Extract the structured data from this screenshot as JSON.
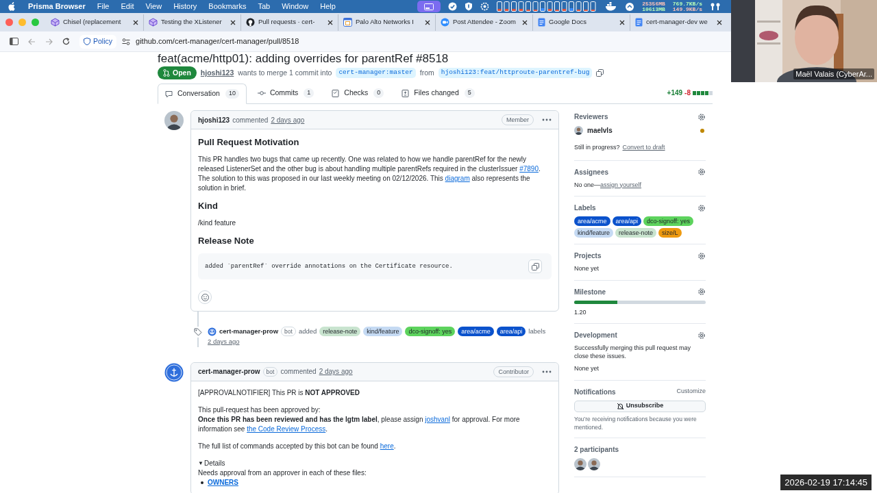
{
  "menu_bar": {
    "app": "Prisma Browser",
    "items": [
      "File",
      "Edit",
      "View",
      "History",
      "Bookmarks",
      "Tab",
      "Window",
      "Help"
    ],
    "stats": [
      [
        "25356MB",
        "10613MB"
      ],
      [
        "769.7KB/s",
        "149.9KB/s"
      ]
    ]
  },
  "browser_tabs": [
    {
      "title": "Chisel (replacement",
      "kind": "cube",
      "selected": false
    },
    {
      "title": "Testing the XListener",
      "kind": "cube",
      "selected": false
    },
    {
      "title": "Pull requests · cert-",
      "kind": "github",
      "selected": false
    },
    {
      "title": "Palo Alto Networks I",
      "kind": "calendar",
      "selected": false
    },
    {
      "title": "Post Attendee - Zoom",
      "kind": "zoom",
      "selected": false
    },
    {
      "title": "Google Docs",
      "kind": "doc",
      "selected": false
    },
    {
      "title": "cert-manager-dev we",
      "kind": "doc",
      "selected": false
    }
  ],
  "address_bar": {
    "policy": "Policy",
    "url": "github.com/cert-manager/cert-manager/pull/8518"
  },
  "pull_request": {
    "title": "feat(acme/http01): adding overrides for parentRef #8518",
    "state": "Open",
    "author": "hjoshi123",
    "merge_text": "wants to merge 1 commit into",
    "base": "cert-manager:master",
    "from": "from",
    "head": "hjoshi123:feat/httproute-parentref-bug",
    "tabs": [
      {
        "label": "Conversation",
        "count": "10",
        "selected": true
      },
      {
        "label": "Commits",
        "count": "1",
        "selected": false
      },
      {
        "label": "Checks",
        "count": "0",
        "selected": false
      },
      {
        "label": "Files changed",
        "count": "5",
        "selected": false
      }
    ],
    "additions": "+149",
    "deletions": "-8"
  },
  "timeline": [
    {
      "kind": "comment",
      "author": "hjoshi123",
      "action": "commented",
      "time": "2 days ago",
      "role": "Member",
      "body": [
        {
          "kind": "heading",
          "text": "Pull Request Motivation"
        },
        {
          "kind": "paragraph",
          "segments": [
            {
              "kind": "text",
              "text": "This PR handles two bugs that came up recently. One was related to how we handle parentRef for the newly released ListenerSet and the other bug is about handling multiple parentRefs required in the clusterIssuer "
            },
            {
              "kind": "link",
              "text": "#7890"
            },
            {
              "kind": "text",
              "text": ". The solution to this was proposed in our last weekly meeting on 02/12/2026. This "
            },
            {
              "kind": "link",
              "text": "diagram"
            },
            {
              "kind": "text",
              "text": " also represents the solution in brief."
            }
          ]
        },
        {
          "kind": "heading",
          "text": "Kind"
        },
        {
          "kind": "paragraph",
          "segments": [
            {
              "kind": "text",
              "text": "/kind feature"
            }
          ]
        },
        {
          "kind": "heading",
          "text": "Release Note"
        },
        {
          "kind": "code",
          "text": "added `parentRef` override annotations on the Certificate resource."
        },
        {
          "kind": "reactions"
        }
      ]
    },
    {
      "kind": "event",
      "author": "cert-manager-prow",
      "badge": "bot",
      "action": "added",
      "labels": [
        {
          "name": "release-note",
          "color": "#c9e4cf"
        },
        {
          "name": "kind/feature",
          "color": "#c5daf3"
        },
        {
          "name": "dco-signoff: yes",
          "color": "#5dd35d"
        },
        {
          "name": "area/acme",
          "color": "#0b52cc"
        },
        {
          "name": "area/api",
          "color": "#0b52cc"
        }
      ],
      "suffix": "labels",
      "time": "2 days ago"
    },
    {
      "kind": "comment",
      "author": "cert-manager-prow",
      "badge": "bot",
      "action": "commented",
      "time": "2 days ago",
      "role": "Contributor",
      "body": [
        {
          "kind": "paragraph",
          "segments": [
            {
              "kind": "text",
              "text": "[APPROVALNOTIFIER] This PR is **NOT APPROVED**"
            }
          ]
        },
        {
          "kind": "line",
          "segments": [
            {
              "kind": "text",
              "text": "This pull-request has been approved by:"
            }
          ]
        },
        {
          "kind": "paragraph",
          "segments": [
            {
              "kind": "text",
              "text": "**Once this PR has been reviewed and has the lgtm label**, please assign "
            },
            {
              "kind": "link",
              "text": "joshvanl"
            },
            {
              "kind": "text",
              "text": " for approval. For more information see "
            },
            {
              "kind": "link",
              "text": "the Code Review Process"
            },
            {
              "kind": "text",
              "text": "."
            }
          ]
        },
        {
          "kind": "paragraph",
          "segments": [
            {
              "kind": "text",
              "text": "The full list of commands accepted by this bot can be found "
            },
            {
              "kind": "link",
              "text": "here"
            },
            {
              "kind": "text",
              "text": "."
            }
          ]
        },
        {
          "kind": "details",
          "marker": "▼",
          "summary": "Details",
          "expanded": true
        },
        {
          "kind": "line",
          "segments": [
            {
              "kind": "text",
              "text": "Needs approval from an approver in each of these files:"
            }
          ]
        },
        {
          "kind": "list",
          "items": [
            "OWNERS"
          ]
        }
      ]
    }
  ],
  "sidebar": {
    "reviewers": {
      "title": "Reviewers",
      "people": [
        {
          "name": "maelvls",
          "pending": true
        }
      ],
      "note": "Still in progress?",
      "action": "Convert to draft"
    },
    "assignees": {
      "title": "Assignees",
      "text": "No one—",
      "action": "assign yourself"
    },
    "labels": {
      "title": "Labels",
      "items": [
        {
          "name": "area/acme",
          "color": "#0b52cc"
        },
        {
          "name": "area/api",
          "color": "#0b52cc"
        },
        {
          "name": "dco-signoff: yes",
          "color": "#5dd35d"
        },
        {
          "name": "kind/feature",
          "color": "#c5daf3"
        },
        {
          "name": "release-note",
          "color": "#c9e4cf"
        },
        {
          "name": "size/L",
          "color": "#ee9a10"
        }
      ]
    },
    "projects": {
      "title": "Projects",
      "text": "None yet"
    },
    "milestone": {
      "title": "Milestone",
      "level": 0.33,
      "name": "1.20"
    },
    "development": {
      "title": "Development",
      "text": "Successfully merging this pull request may close these issues.",
      "value": "None yet"
    },
    "notifications": {
      "title": "Notifications",
      "action": "Customize",
      "button": "Unsubscribe",
      "note": "You’re receiving notifications because you were mentioned."
    },
    "participants": {
      "title": "2 participants"
    }
  },
  "video_overlay": {
    "name": "Maël Valais (CyberAr..."
  },
  "timestamp": "2026-02-19 17:14:45"
}
